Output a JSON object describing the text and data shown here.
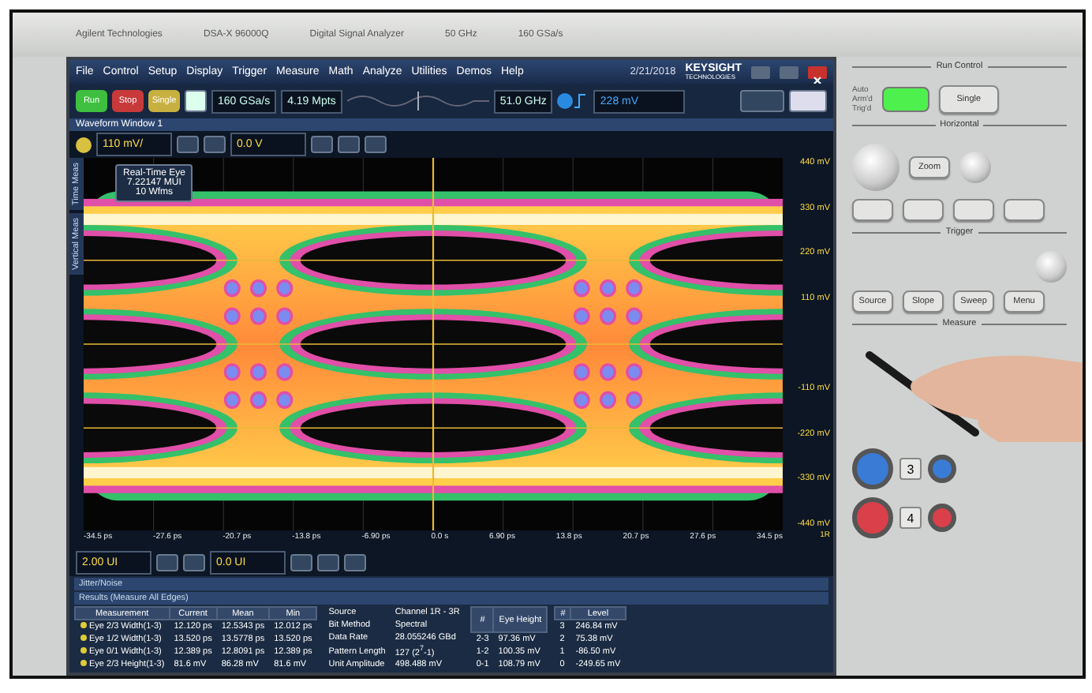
{
  "bezel": {
    "brand": "Agilent Technologies",
    "model": "DSA-X 96000Q",
    "product": "Digital Signal Analyzer",
    "bandwidth": "50 GHz",
    "sample_rate": "160 GSa/s"
  },
  "menu": [
    "File",
    "Control",
    "Setup",
    "Display",
    "Trigger",
    "Measure",
    "Math",
    "Analyze",
    "Utilities",
    "Demos",
    "Help"
  ],
  "clock": {
    "date": "2/21/2018"
  },
  "logo": {
    "name": "KEYSIGHT",
    "sub": "TECHNOLOGIES"
  },
  "run_buttons": [
    {
      "label": "Run",
      "color": "#3fbf3f"
    },
    {
      "label": "Stop",
      "color": "#c83a3a"
    },
    {
      "label": "Single",
      "color": "#c8b040"
    }
  ],
  "acquisition": {
    "sample_rate": "160 GSa/s",
    "memory": "4.19 Mpts",
    "bandwidth": "51.0 GHz",
    "trigger_level": "228 mV"
  },
  "waveform_window": {
    "title": "Waveform Window 1",
    "scale": "110 mV/",
    "offset": "0.0 V",
    "side_tabs": [
      "Time Meas",
      "Vertical Meas"
    ],
    "label": [
      "Real-Time Eye",
      "7.22147 MUI",
      "10 Wfms"
    ],
    "y_ticks": [
      "440 mV",
      "330 mV",
      "220 mV",
      "110 mV",
      "-110 mV",
      "-220 mV",
      "-330 mV",
      "-440 mV"
    ],
    "x_ticks": [
      "-34.5 ps",
      "-27.6 ps",
      "-20.7 ps",
      "-13.8 ps",
      "-6.90 ps",
      "0.0 s",
      "6.90 ps",
      "13.8 ps",
      "20.7 ps",
      "27.6 ps",
      "34.5 ps"
    ],
    "marker": "1R",
    "time_scale": "2.00 UI",
    "time_offset": "0.0 UI"
  },
  "results": {
    "panel": "Jitter/Noise",
    "title": "Results (Measure All Edges)",
    "columns": [
      "Measurement",
      "Current",
      "Mean",
      "Min"
    ],
    "rows": [
      [
        "Eye 2/3 Width(1-3)",
        "12.120 ps",
        "12.5343 ps",
        "12.012 ps"
      ],
      [
        "Eye 1/2 Width(1-3)",
        "13.520 ps",
        "13.5778 ps",
        "13.520 ps"
      ],
      [
        "Eye 0/1 Width(1-3)",
        "12.389 ps",
        "12.8091 ps",
        "12.389 ps"
      ],
      [
        "Eye 2/3 Height(1-3)",
        "81.6 mV",
        "86.28 mV",
        "81.6 mV"
      ]
    ]
  },
  "info": [
    {
      "label": "Source",
      "value": "Channel 1R - 3R"
    },
    {
      "label": "Bit Method",
      "value": "Spectral"
    },
    {
      "label": "Data Rate",
      "value": "28.055246 GBd"
    },
    {
      "label": "Pattern Length",
      "value": "127 (2$^{7}$-1)"
    },
    {
      "label": "Unit Amplitude",
      "value": "498.488 mV"
    }
  ],
  "eye_heights": {
    "columns": [
      "#",
      "Eye Height"
    ],
    "rows": [
      [
        "2-3",
        "97.36 mV"
      ],
      [
        "1-2",
        "100.35 mV"
      ],
      [
        "0-1",
        "108.79 mV"
      ]
    ]
  },
  "levels": {
    "columns": [
      "#",
      "Level"
    ],
    "rows": [
      [
        "3",
        "246.84 mV"
      ],
      [
        "2",
        "75.38 mV"
      ],
      [
        "1",
        "-86.50 mV"
      ],
      [
        "0",
        "-249.65 mV"
      ]
    ]
  },
  "front_panel": {
    "run_control": "Run Control",
    "run_states": [
      "Auto",
      "Arm'd",
      "Trig'd"
    ],
    "single": "Single",
    "horizontal": "Horizontal",
    "zoom": "Zoom",
    "trigger": "Trigger",
    "trigger_buttons": [
      "Source",
      "Slope",
      "Sweep",
      "Menu"
    ],
    "measure": "Measure",
    "channels": [
      {
        "label": "3",
        "color": "#3a7bd5"
      },
      {
        "label": "4",
        "color": "#d9404a"
      }
    ]
  }
}
